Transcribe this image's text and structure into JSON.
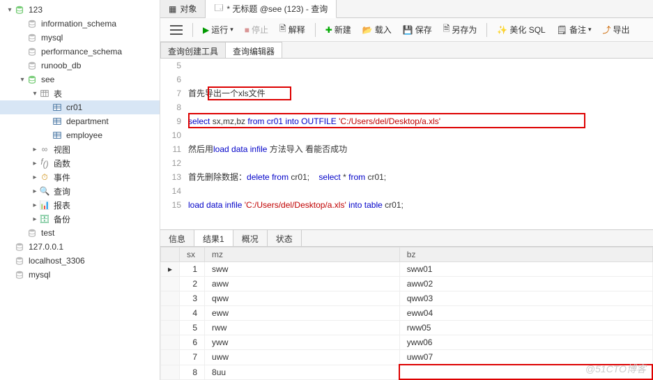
{
  "tree": [
    {
      "depth": 0,
      "exp": "▾",
      "icon": "db-green",
      "label": "123"
    },
    {
      "depth": 1,
      "exp": "",
      "icon": "db-grey",
      "label": "information_schema"
    },
    {
      "depth": 1,
      "exp": "",
      "icon": "db-grey",
      "label": "mysql"
    },
    {
      "depth": 1,
      "exp": "",
      "icon": "db-grey",
      "label": "performance_schema"
    },
    {
      "depth": 1,
      "exp": "",
      "icon": "db-grey",
      "label": "runoob_db"
    },
    {
      "depth": 1,
      "exp": "▾",
      "icon": "db-green",
      "label": "see"
    },
    {
      "depth": 2,
      "exp": "▾",
      "icon": "folder",
      "label": "表"
    },
    {
      "depth": 3,
      "exp": "",
      "icon": "table",
      "label": "cr01",
      "selected": true
    },
    {
      "depth": 3,
      "exp": "",
      "icon": "table",
      "label": "department"
    },
    {
      "depth": 3,
      "exp": "",
      "icon": "table",
      "label": "employee"
    },
    {
      "depth": 2,
      "exp": "▸",
      "icon": "view",
      "label": "视图"
    },
    {
      "depth": 2,
      "exp": "▸",
      "icon": "func",
      "label": "函数"
    },
    {
      "depth": 2,
      "exp": "▸",
      "icon": "event",
      "label": "事件"
    },
    {
      "depth": 2,
      "exp": "▸",
      "icon": "query",
      "label": "查询"
    },
    {
      "depth": 2,
      "exp": "▸",
      "icon": "report",
      "label": "报表"
    },
    {
      "depth": 2,
      "exp": "▸",
      "icon": "backup",
      "label": "备份"
    },
    {
      "depth": 1,
      "exp": "",
      "icon": "db-grey",
      "label": "test"
    },
    {
      "depth": 0,
      "exp": "",
      "icon": "db-grey",
      "label": "127.0.0.1"
    },
    {
      "depth": 0,
      "exp": "",
      "icon": "db-grey",
      "label": "localhost_3306"
    },
    {
      "depth": 0,
      "exp": "",
      "icon": "db-grey",
      "label": "mysql"
    }
  ],
  "tabs": {
    "obj": "对象",
    "query": "* 无标题 @see (123) - 查询"
  },
  "toolbar": {
    "run": "运行",
    "stop": "停止",
    "explain": "解释",
    "new": "新建",
    "load": "载入",
    "save": "保存",
    "saveas": "另存为",
    "beautify": "美化 SQL",
    "note": "备注",
    "export": "导出"
  },
  "subtabs": {
    "builder": "查询创建工具",
    "editor": "查询编辑器"
  },
  "editor": {
    "start": 5,
    "lines": [
      "",
      "",
      "首先|导出一个xls文件|",
      "",
      "|select| sx,mz,bz |from| |cr01| |into| |OUTFILE| |'C:/Users/del/Desktop/a.xls'|",
      "",
      "然后用|load| |data| |infile| 方法导入 看能否成功",
      "",
      "首先删除数据：|delete| |from| cr01;    |select| * |from| cr01;",
      "",
      "|load| |data| |infile| |'C:/Users/del/Desktop/a.xls'| |into| |table| cr01;"
    ]
  },
  "rtabs": {
    "info": "信息",
    "result": "结果1",
    "profile": "概况",
    "status": "状态"
  },
  "grid": {
    "cols": [
      "sx",
      "mz",
      "bz"
    ],
    "rows": [
      [
        "1",
        "sww",
        "sww01"
      ],
      [
        "2",
        "aww",
        "aww02"
      ],
      [
        "3",
        "qww",
        "qww03"
      ],
      [
        "4",
        "eww",
        "eww04"
      ],
      [
        "5",
        "rww",
        "rww05"
      ],
      [
        "6",
        "yww",
        "yww06"
      ],
      [
        "7",
        "uww",
        "uww07"
      ],
      [
        "8",
        "8uu",
        ""
      ]
    ]
  },
  "watermark": "@51CTO博客"
}
